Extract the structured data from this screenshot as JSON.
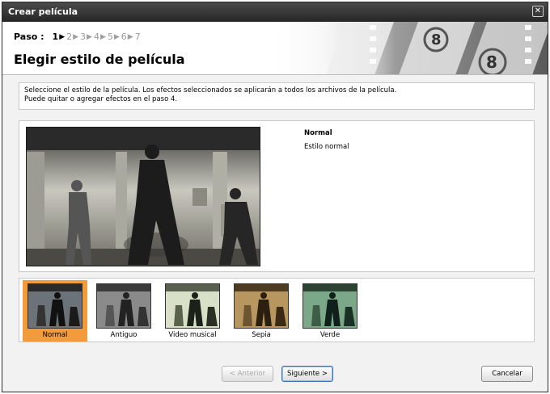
{
  "window": {
    "title": "Crear película",
    "close_glyph": "✕"
  },
  "steps": {
    "label": "Paso :",
    "items": [
      {
        "num": "1",
        "active": true
      },
      {
        "num": "2",
        "active": false
      },
      {
        "num": "3",
        "active": false
      },
      {
        "num": "4",
        "active": false
      },
      {
        "num": "5",
        "active": false
      },
      {
        "num": "6",
        "active": false
      },
      {
        "num": "7",
        "active": false
      }
    ]
  },
  "page": {
    "title": "Elegir estilo de película"
  },
  "description": {
    "line1": "Seleccione el estilo de la película. Los efectos seleccionados se aplicarán a todos los archivos de la película.",
    "line2": "Puede quitar o agregar efectos en el paso 4."
  },
  "preview": {
    "style_name": "Normal",
    "style_description": "Estilo normal"
  },
  "styles": [
    {
      "label": "Normal",
      "selected": true,
      "tint": "#6b7378"
    },
    {
      "label": "Antiguo",
      "selected": false,
      "tint": "#8a8a8a"
    },
    {
      "label": "Video musical",
      "selected": false,
      "tint": "#b9c6a6"
    },
    {
      "label": "Sepia",
      "selected": false,
      "tint": "#a88a5a"
    },
    {
      "label": "Verde",
      "selected": false,
      "tint": "#6f9a7a"
    }
  ],
  "buttons": {
    "back": "< Anterior",
    "next": "Siguiente >",
    "cancel": "Cancelar"
  },
  "colors": {
    "selection": "#f39a3a",
    "titlebar": "#2f2f2f"
  }
}
